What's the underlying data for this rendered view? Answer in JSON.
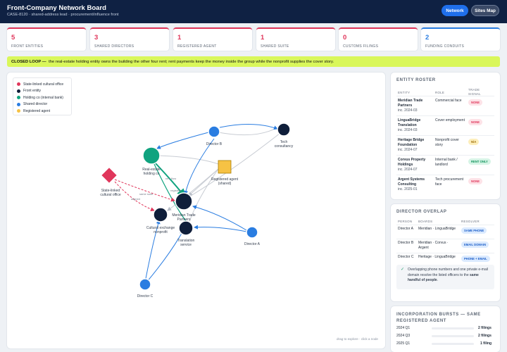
{
  "header": {
    "title": "Front-Company Network Board",
    "subtitle": "CASE-8120 · shared-address lead · procurement/influence front",
    "nav": [
      "Network",
      "Sites Map"
    ]
  },
  "kpis": [
    {
      "value": "5",
      "label": "FRONT ENTITIES"
    },
    {
      "value": "3",
      "label": "SHARED DIRECTORS"
    },
    {
      "value": "1",
      "label": "REGISTERED AGENT"
    },
    {
      "value": "1",
      "label": "SHARED SUITE"
    },
    {
      "value": "0",
      "label": "CUSTOMS FILINGS"
    },
    {
      "value": "2",
      "label": "FUNDING CONDUITS"
    }
  ],
  "banner": {
    "lead": "CLOSED LOOP —",
    "text": "the real-estate holding entity owns the building the other four rent; rent payments keep the money inside the group while the nonprofit supplies the cover story."
  },
  "legend": [
    {
      "label": "State-linked cultural office",
      "color": "#e0365b"
    },
    {
      "label": "Front entity",
      "color": "#0f1e3a"
    },
    {
      "label": "Holding co (internal bank)",
      "color": "#10a37f"
    },
    {
      "label": "Shared director",
      "color": "#2a7de1"
    },
    {
      "label": "Registered agent",
      "color": "#f6c244"
    }
  ],
  "graph": {
    "hint": "drag to explore · click a node",
    "nodes": {
      "state": "State-linked\ncultural office",
      "holding": "Real-estate\nholding co",
      "agent": "Registered agent\n(shared)",
      "tech": "Tech\nconsultancy",
      "dirB": "Director B",
      "meridian": "Meridian Trade\nPartners",
      "cultural": "Cultural exchange\nnonprofit",
      "trans": "Translation\nservice",
      "dirA": "Director A",
      "dirC": "Director C"
    },
    "edges": {
      "rent_flow": "rent flow",
      "same_suite": "same suite",
      "aligned": "aligned",
      "registers": "registers"
    }
  },
  "roster": {
    "title": "ENTITY ROSTER",
    "headers": [
      "ENTITY",
      "ROLE",
      "TRADE SIGNAL"
    ],
    "rows": [
      {
        "name": "Meridian Trade Partners",
        "inc": "inc. 2024-03",
        "role": "Commercial face",
        "signal": "NONE"
      },
      {
        "name": "LinguaBridge Translation",
        "inc": "inc. 2024-03",
        "role": "Cover employment",
        "signal": "NONE"
      },
      {
        "name": "Heritage Bridge Foundation",
        "inc": "inc. 2024-07",
        "role": "Nonprofit cover story",
        "signal": "N/A"
      },
      {
        "name": "Corvus Property Holdings",
        "inc": "inc. 2024-07",
        "role": "Internal bank / landlord",
        "signal": "RENT ONLY"
      },
      {
        "name": "Argent Systems Consulting",
        "inc": "inc. 2025-01",
        "role": "Tech procurement face",
        "signal": "NONE"
      }
    ]
  },
  "overlap": {
    "title": "DIRECTOR OVERLAP",
    "headers": [
      "PERSON",
      "BOARDS",
      "RESOLVER"
    ],
    "rows": [
      {
        "person": "Director A",
        "boards": "Meridian · LinguaBridge",
        "resolver": "SAME PHONE"
      },
      {
        "person": "Director B",
        "boards": "Meridian · Corvus · Argent",
        "resolver": "EMAIL DOMAIN"
      },
      {
        "person": "Director C",
        "boards": "Heritage · LinguaBridge",
        "resolver": "PHONE + EMAIL"
      }
    ],
    "note_pre": "Overlapping phone numbers and one private e-mail domain resolve the listed officers to the ",
    "note_bold": "same handful of people",
    "note_post": "."
  },
  "bursts": {
    "title": "INCORPORATION BURSTS — SAME REGISTERED AGENT",
    "rows": [
      {
        "q": "2024 Q1",
        "v": "2 filings",
        "fill": 1.0
      },
      {
        "q": "2024 Q3",
        "v": "2 filings",
        "fill": 1.0
      },
      {
        "q": "2025 Q1",
        "v": "1 filing",
        "fill": 0.5
      }
    ]
  },
  "colors": {
    "red": "#e0365b",
    "navy": "#0f1e3a",
    "green": "#10a37f",
    "blue": "#2a7de1",
    "gold": "#f6c244"
  }
}
